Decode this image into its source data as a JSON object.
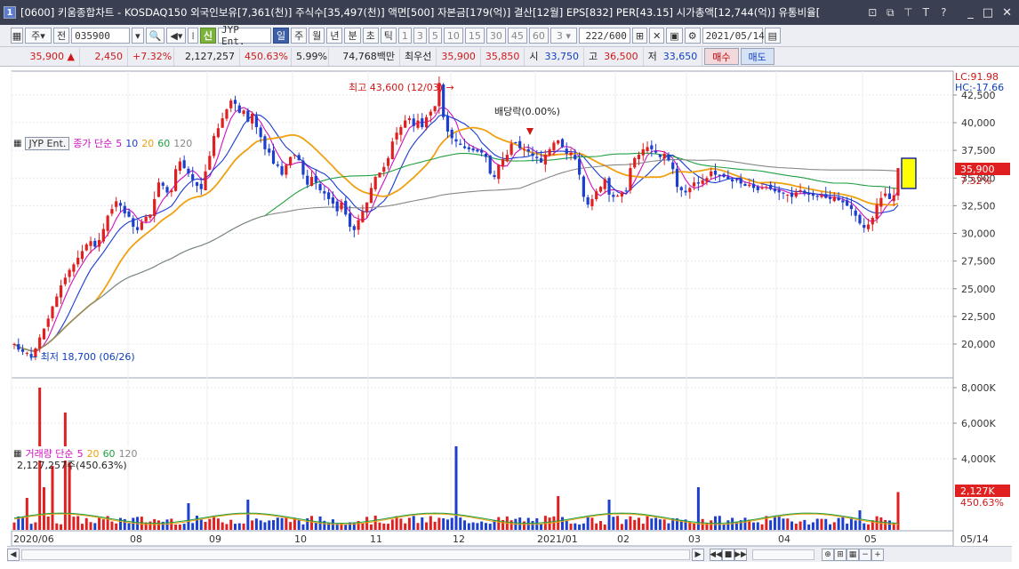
{
  "titlebar": {
    "window_number": "1",
    "title": "[0600] 키움종합차트 - KOSDAQ150 외국인보유[7,361(천)] 주식수[35,497(천)] 액면[500] 자본금[179(억)] 결산[12월] EPS[832] PER[43.15] 시가총액[12,744(억)] 유통비율[",
    "buttons": [
      "□",
      "⧉",
      "T",
      "T",
      "?"
    ],
    "window_controls": [
      "_",
      "□",
      "×"
    ]
  },
  "toolbar": {
    "market_type": "주",
    "period_prefix": "전",
    "stock_code": "035900",
    "stock_tag": "신",
    "stock_name": "JYP Ent.",
    "periods": [
      "일",
      "주",
      "월",
      "년",
      "분",
      "초",
      "틱"
    ],
    "active_period": "일",
    "minute_options": [
      "1",
      "3",
      "5",
      "10",
      "15",
      "30",
      "45",
      "60"
    ],
    "custom_value": "3",
    "data_count": "222",
    "data_max": "/600",
    "date": "2021/05/14"
  },
  "quote": {
    "price": "35,900",
    "direction": "▲",
    "change": "2,450",
    "change_pct": "+7.32%",
    "volume": "2,127,257",
    "volume_pct": "450.63%",
    "turnover": "5.99%",
    "amount": "74,768백만",
    "priority_label": "최우선",
    "ask": "35,900",
    "bid": "35,850",
    "open_label": "시",
    "open": "33,750",
    "high_label": "고",
    "high": "36,500",
    "low_label": "저",
    "low": "33,650",
    "buy_label": "매수",
    "sell_label": "매도"
  },
  "price_legend": {
    "name": "JYP Ent.",
    "series_label": "종가 단순",
    "ma": [
      "5",
      "10",
      "20",
      "60",
      "120"
    ]
  },
  "volume_legend": {
    "series_label": "거래량 단순",
    "ma": [
      "5",
      "20",
      "60",
      "120"
    ],
    "info": "2,127,257주(450.63%)"
  },
  "annotations": {
    "high": "최고 43,600 (12/03)",
    "low": "최저 18,700 (06/26)",
    "dividend": "배당락(0.00%)"
  },
  "right_axis": {
    "lc": "LC:91.98",
    "hc": "HC:-17.66",
    "price_ticks": [
      "42,500",
      "40,000",
      "37,500",
      "35,000",
      "32,500",
      "30,000",
      "27,500",
      "25,000",
      "22,500",
      "20,000"
    ],
    "current_price": "35,900",
    "current_pct": "7.32%",
    "volume_ticks": [
      "8,000K",
      "6,000K",
      "4,000K"
    ],
    "current_volume": "2,127K",
    "current_volume_pct": "450.63%"
  },
  "x_axis": {
    "labels": [
      "2020/06",
      "08",
      "09",
      "10",
      "11",
      "12",
      "2021/01",
      "02",
      "03",
      "04",
      "05",
      "05/14"
    ]
  },
  "colors": {
    "up": "#e02020",
    "down": "#1c3fd0",
    "ma5": "#d010c0",
    "ma10": "#1a3ad0",
    "ma20": "#f0a010",
    "ma60": "#20a040",
    "ma120": "#888888",
    "highlight": "#ffff00"
  },
  "chart_data": {
    "type": "candlestick",
    "ylim": [
      17500,
      44000
    ],
    "close_ma_seed": [
      20000,
      19500,
      19300,
      19200,
      18900,
      19600,
      20600,
      21400,
      22300,
      23400,
      24300,
      25300,
      26000,
      26700,
      27200,
      27800,
      28400,
      29000,
      29300,
      28800,
      29400,
      30400,
      31600,
      32200,
      32900,
      32500,
      31800,
      31500,
      30600,
      30300,
      31000,
      31500,
      31700,
      33100,
      34600,
      34300,
      33700,
      33900,
      35800,
      36500,
      35900,
      35400,
      34800,
      34300,
      34000,
      35600,
      37000,
      38800,
      39500,
      40400,
      41200,
      42000,
      41700,
      40900,
      41100,
      40100,
      40800,
      39600,
      38700,
      37600,
      37300,
      36300,
      36100,
      35300,
      36200,
      36900,
      37100,
      36600,
      35300,
      34400,
      35100,
      34600,
      33900,
      33600,
      33100,
      32700,
      32000,
      32800,
      31700,
      30600,
      30300,
      31200,
      32000,
      32800,
      34100,
      35100,
      35500,
      36000,
      36800,
      38300,
      39100,
      39600,
      40200,
      40400,
      39700,
      40200,
      39600,
      40500,
      41000,
      41500,
      43600,
      40500,
      39200,
      38600,
      38300,
      38000,
      37700,
      37600,
      37500,
      37400,
      37300,
      36900,
      35400,
      35100,
      36200,
      36700,
      37100,
      38100,
      38200,
      37700,
      37600,
      37400,
      37000,
      36800,
      36400,
      37100,
      37600,
      38200,
      38400,
      37800,
      37200,
      37300,
      36700,
      35300,
      33300,
      32600,
      33100,
      33800,
      34200,
      34900,
      33500,
      33300,
      33400,
      33700,
      33800,
      35900,
      36800,
      37100,
      37600,
      37800,
      37600,
      37300,
      36900,
      37200,
      36600,
      35800,
      34200,
      33900,
      33700,
      34100,
      34600,
      34500,
      34800,
      35000,
      35600,
      35300,
      35200,
      35100,
      34900,
      34700,
      34800,
      34500,
      34300,
      34400,
      34100,
      33900,
      34100,
      34200,
      34000,
      33800,
      33700,
      33600,
      33500,
      33300,
      33700,
      33900,
      33600,
      33500,
      33400,
      33300,
      33400,
      33200,
      33100,
      33300,
      33000,
      32800,
      32500,
      32200,
      31600,
      30900,
      30500,
      30800,
      31400,
      32600,
      33200,
      33600,
      33100,
      33450,
      35900
    ]
  }
}
